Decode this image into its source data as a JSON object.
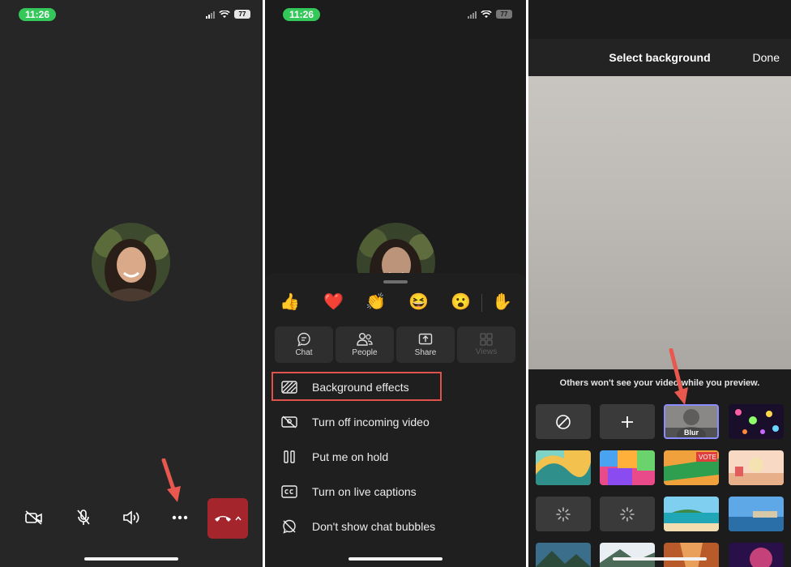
{
  "panel1": {
    "status_time": "11:26",
    "battery": "77",
    "controls": [
      "video-off",
      "mic-off",
      "speaker",
      "more"
    ],
    "hangup_color": "#a4262c"
  },
  "panel2": {
    "status_time": "11:26",
    "battery": "77",
    "reactions": [
      "👍",
      "❤️",
      "👏",
      "😆",
      "😮",
      "✋"
    ],
    "tiles": [
      {
        "label": "Chat",
        "icon": "chat-icon"
      },
      {
        "label": "People",
        "icon": "people-icon"
      },
      {
        "label": "Share",
        "icon": "share-icon"
      },
      {
        "label": "Views",
        "icon": "views-icon"
      }
    ],
    "menu": [
      {
        "label": "Background effects",
        "icon": "background-effects-icon"
      },
      {
        "label": "Turn off incoming video",
        "icon": "video-off-icon"
      },
      {
        "label": "Put me on hold",
        "icon": "pause-icon"
      },
      {
        "label": "Turn on live captions",
        "icon": "captions-icon"
      },
      {
        "label": "Don't show chat bubbles",
        "icon": "chat-off-icon"
      }
    ],
    "highlight_color": "#e0524c"
  },
  "panel3": {
    "title": "Select background",
    "done_label": "Done",
    "preview_note": "Others won't see your video while you preview.",
    "blur_label": "Blur",
    "accent_color": "#8b8dff"
  }
}
